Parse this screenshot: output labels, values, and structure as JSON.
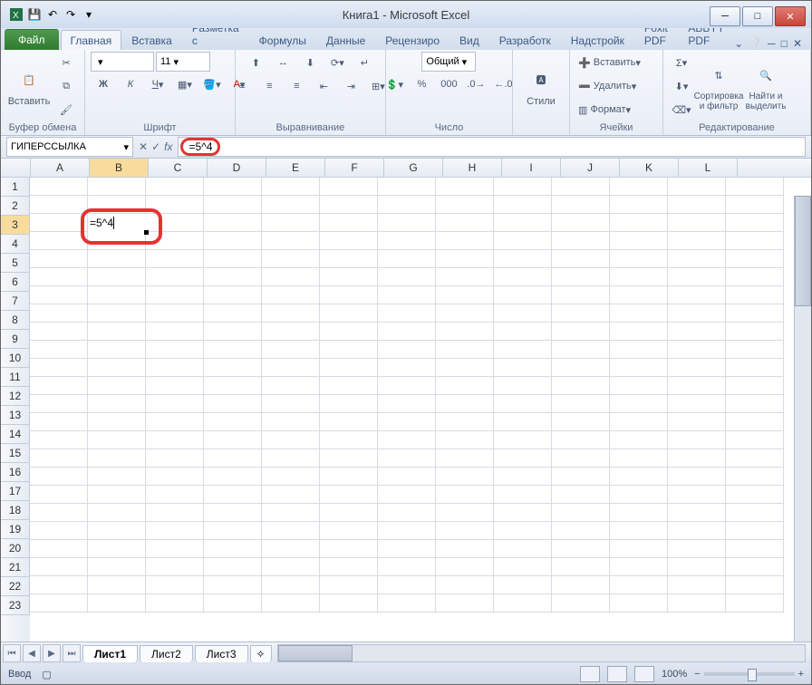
{
  "title": "Книга1 - Microsoft Excel",
  "tabs": {
    "file": "Файл",
    "home": "Главная",
    "insert": "Вставка",
    "layout": "Разметка с",
    "formulas": "Формулы",
    "data": "Данные",
    "review": "Рецензиро",
    "view": "Вид",
    "developer": "Разработк",
    "addins": "Надстройк",
    "foxit": "Foxit PDF",
    "abbyy": "ABBYY PDF"
  },
  "groups": {
    "clipboard": "Буфер обмена",
    "font": "Шрифт",
    "alignment": "Выравнивание",
    "number": "Число",
    "styles": "Стили",
    "cells": "Ячейки",
    "editing": "Редактирование"
  },
  "clipboard": {
    "paste": "Вставить"
  },
  "font": {
    "size": "11"
  },
  "number": {
    "general": "Общий"
  },
  "styles": {
    "label": "Стили"
  },
  "cells_cmd": {
    "insert": "Вставить",
    "delete": "Удалить",
    "format": "Формат"
  },
  "editing": {
    "sort": "Сортировка и фильтр",
    "find": "Найти и выделить"
  },
  "namebox": "ГИПЕРССЫЛКА",
  "formula": "=5^4",
  "cell_value": "=5^4",
  "columns": [
    "A",
    "B",
    "C",
    "D",
    "E",
    "F",
    "G",
    "H",
    "I",
    "J",
    "K",
    "L"
  ],
  "rows": [
    "1",
    "2",
    "3",
    "4",
    "5",
    "6",
    "7",
    "8",
    "9",
    "10",
    "11",
    "12",
    "13",
    "14",
    "15",
    "16",
    "17",
    "18",
    "19",
    "20",
    "21",
    "22",
    "23"
  ],
  "sheets": {
    "s1": "Лист1",
    "s2": "Лист2",
    "s3": "Лист3"
  },
  "status": "Ввод",
  "zoom": "100%"
}
